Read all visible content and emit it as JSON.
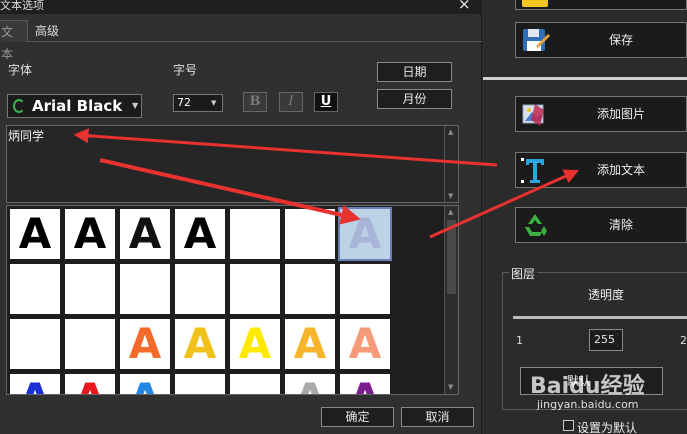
{
  "dialog": {
    "title": "文本选项",
    "tabs": [
      "文本",
      "高级"
    ],
    "font_label": "字体",
    "font_value": "Arial Black",
    "size_label": "字号",
    "size_value": "72",
    "date_button": "日期",
    "month_button": "月份",
    "bold_glyph": "B",
    "italic_glyph": "I",
    "underline_glyph": "U",
    "text_value": "炳同学",
    "style_letter": "A",
    "ok_button": "确定",
    "cancel_button": "取消",
    "close_glyph": "×"
  },
  "sidebar": {
    "save_label": "保存",
    "add_image_label": "添加图片",
    "add_text_label": "添加文本",
    "clear_label": "清除",
    "layer_group_label": "图层",
    "opacity_label": "透明度",
    "opacity_min": "1",
    "opacity_value": "255",
    "opacity_max": "2",
    "default_button": "默认",
    "set_default_label": "设置为默认"
  },
  "watermark": {
    "text": "Baidu经验",
    "url": "jingyan.baidu.com"
  },
  "colors": {
    "arrow": "#e8322f",
    "accent_selected": "#6a7fb8"
  }
}
